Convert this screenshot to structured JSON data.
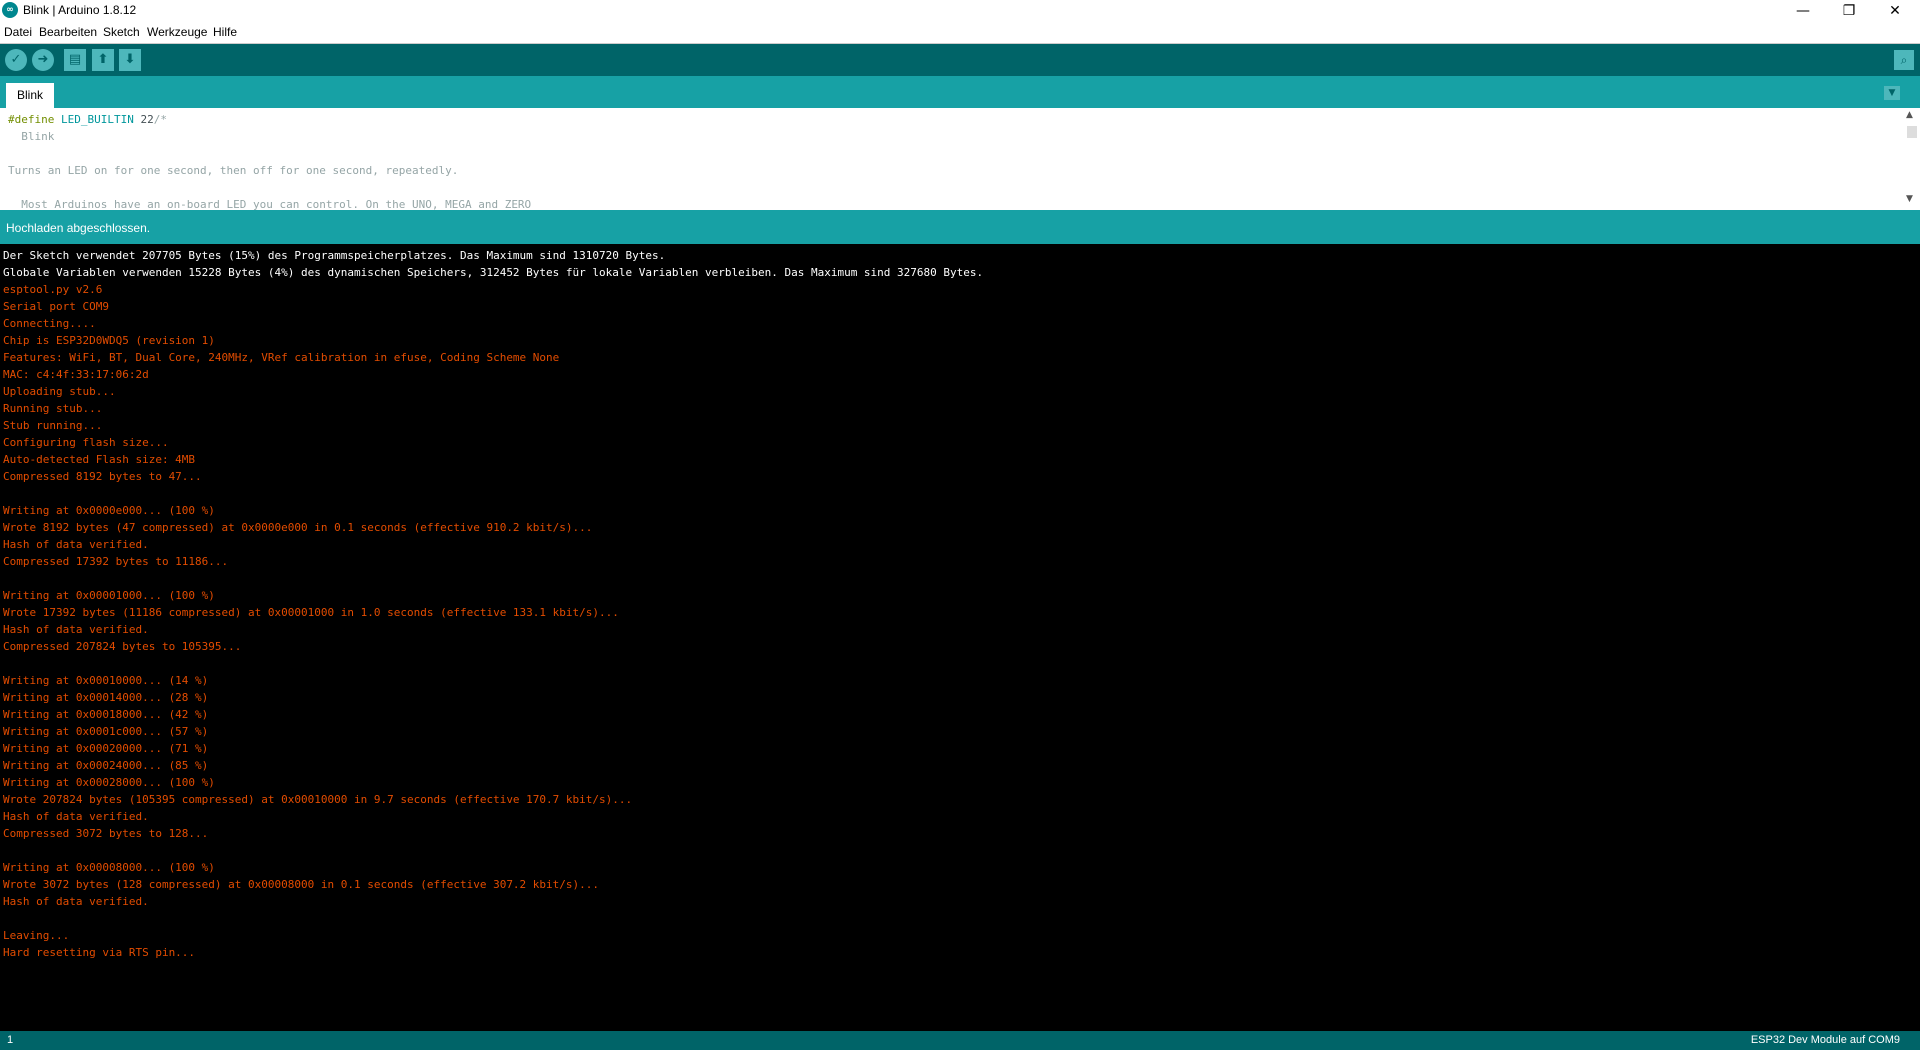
{
  "window": {
    "title": "Blink | Arduino 1.8.12",
    "icon": "arduino-logo-icon",
    "icon_glyph": "∞",
    "controls": {
      "minimize": "—",
      "maximize": "❐",
      "close": "✕"
    }
  },
  "menubar": {
    "items": [
      "Datei",
      "Bearbeiten",
      "Sketch",
      "Werkzeuge",
      "Hilfe"
    ]
  },
  "toolbar": {
    "buttons": [
      {
        "name": "verify",
        "icon": "checkmark-icon",
        "glyph": "✓"
      },
      {
        "name": "upload",
        "icon": "arrow-right-icon",
        "glyph": "➜"
      },
      {
        "name": "new",
        "icon": "new-file-icon",
        "glyph": "▤"
      },
      {
        "name": "open",
        "icon": "arrow-up-icon",
        "glyph": "⬆"
      },
      {
        "name": "save",
        "icon": "arrow-down-icon",
        "glyph": "⬇"
      }
    ],
    "serial_monitor": {
      "icon": "magnifier-icon",
      "glyph": "⌕"
    }
  },
  "tabs": {
    "active": "Blink",
    "menu_glyph": "▼"
  },
  "editor": {
    "line1": {
      "keyword": "#define",
      "constant": "LED_BUILTIN",
      "value": "22",
      "comment_open": "/*"
    },
    "line2": "  Blink",
    "line3": "",
    "line4": "Turns an LED on for one second, then off for one second, repeatedly.",
    "line5": "",
    "line6": "  Most Arduinos have an on-board LED you can control. On the UNO, MEGA and ZERO",
    "scroll_up": "▲",
    "scroll_down": "▼"
  },
  "status": {
    "message": "Hochladen abgeschlossen."
  },
  "console": {
    "lines": [
      {
        "text": "Der Sketch verwendet 207705 Bytes (15%) des Programmspeicherplatzes. Das Maximum sind 1310720 Bytes.",
        "color": "white"
      },
      {
        "text": "Globale Variablen verwenden 15228 Bytes (4%) des dynamischen Speichers, 312452 Bytes für lokale Variablen verbleiben. Das Maximum sind 327680 Bytes.",
        "color": "white"
      },
      {
        "text": "esptool.py v2.6",
        "color": "orange"
      },
      {
        "text": "Serial port COM9",
        "color": "orange"
      },
      {
        "text": "Connecting....",
        "color": "orange"
      },
      {
        "text": "Chip is ESP32D0WDQ5 (revision 1)",
        "color": "orange"
      },
      {
        "text": "Features: WiFi, BT, Dual Core, 240MHz, VRef calibration in efuse, Coding Scheme None",
        "color": "orange"
      },
      {
        "text": "MAC: c4:4f:33:17:06:2d",
        "color": "orange"
      },
      {
        "text": "Uploading stub...",
        "color": "orange"
      },
      {
        "text": "Running stub...",
        "color": "orange"
      },
      {
        "text": "Stub running...",
        "color": "orange"
      },
      {
        "text": "Configuring flash size...",
        "color": "orange"
      },
      {
        "text": "Auto-detected Flash size: 4MB",
        "color": "orange"
      },
      {
        "text": "Compressed 8192 bytes to 47...",
        "color": "orange"
      },
      {
        "text": "",
        "color": "orange"
      },
      {
        "text": "Writing at 0x0000e000... (100 %)",
        "color": "orange"
      },
      {
        "text": "Wrote 8192 bytes (47 compressed) at 0x0000e000 in 0.1 seconds (effective 910.2 kbit/s)...",
        "color": "orange"
      },
      {
        "text": "Hash of data verified.",
        "color": "orange"
      },
      {
        "text": "Compressed 17392 bytes to 11186...",
        "color": "orange"
      },
      {
        "text": "",
        "color": "orange"
      },
      {
        "text": "Writing at 0x00001000... (100 %)",
        "color": "orange"
      },
      {
        "text": "Wrote 17392 bytes (11186 compressed) at 0x00001000 in 1.0 seconds (effective 133.1 kbit/s)...",
        "color": "orange"
      },
      {
        "text": "Hash of data verified.",
        "color": "orange"
      },
      {
        "text": "Compressed 207824 bytes to 105395...",
        "color": "orange"
      },
      {
        "text": "",
        "color": "orange"
      },
      {
        "text": "Writing at 0x00010000... (14 %)",
        "color": "orange"
      },
      {
        "text": "Writing at 0x00014000... (28 %)",
        "color": "orange"
      },
      {
        "text": "Writing at 0x00018000... (42 %)",
        "color": "orange"
      },
      {
        "text": "Writing at 0x0001c000... (57 %)",
        "color": "orange"
      },
      {
        "text": "Writing at 0x00020000... (71 %)",
        "color": "orange"
      },
      {
        "text": "Writing at 0x00024000... (85 %)",
        "color": "orange"
      },
      {
        "text": "Writing at 0x00028000... (100 %)",
        "color": "orange"
      },
      {
        "text": "Wrote 207824 bytes (105395 compressed) at 0x00010000 in 9.7 seconds (effective 170.7 kbit/s)...",
        "color": "orange"
      },
      {
        "text": "Hash of data verified.",
        "color": "orange"
      },
      {
        "text": "Compressed 3072 bytes to 128...",
        "color": "orange"
      },
      {
        "text": "",
        "color": "orange"
      },
      {
        "text": "Writing at 0x00008000... (100 %)",
        "color": "orange"
      },
      {
        "text": "Wrote 3072 bytes (128 compressed) at 0x00008000 in 0.1 seconds (effective 307.2 kbit/s)...",
        "color": "orange"
      },
      {
        "text": "Hash of data verified.",
        "color": "orange"
      },
      {
        "text": "",
        "color": "orange"
      },
      {
        "text": "Leaving...",
        "color": "orange"
      },
      {
        "text": "Hard resetting via RTS pin...",
        "color": "orange"
      }
    ]
  },
  "footer": {
    "line_number": "1",
    "board": "ESP32 Dev Module auf COM9"
  },
  "colors": {
    "toolbar": "#006468",
    "tabbar": "#17A1A5",
    "console_text": "#e34c00"
  }
}
